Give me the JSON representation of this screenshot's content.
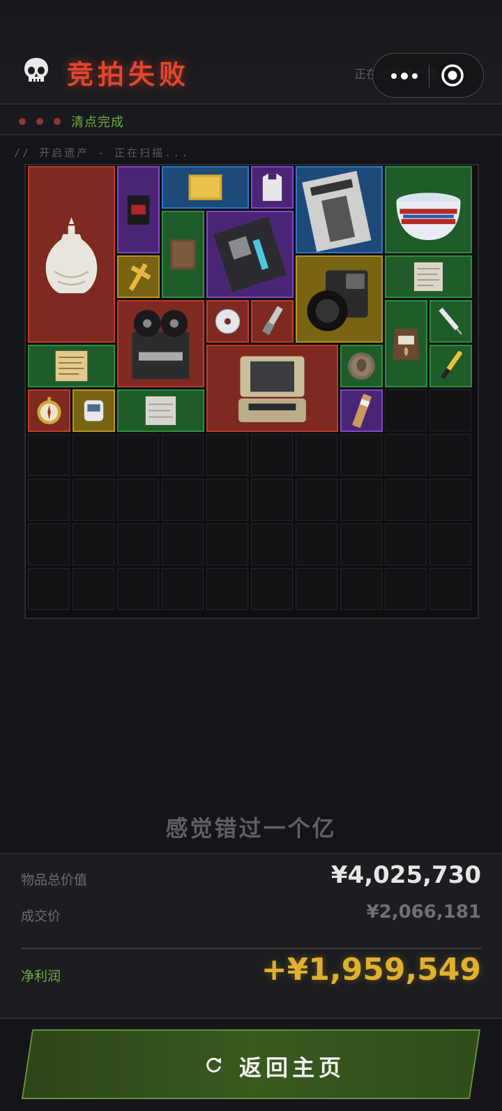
{
  "header": {
    "title": "竞拍失败",
    "restore_text": "正在还原遗产情...",
    "skull_icon": "skull-icon"
  },
  "status": {
    "text": "清点完成"
  },
  "scan": {
    "text": "// 开启遗产 - 正在扫描..."
  },
  "colors": {
    "red": "#c23a2b",
    "purple": "#8346c8",
    "gold": "#b59526",
    "blue": "#2f79c2",
    "green": "#2f8e3c",
    "profit": "#e0b02e",
    "accent_green": "#6fae45"
  },
  "grid": {
    "columns": 10,
    "rows": 10,
    "items": [
      {
        "name": "celadon-vase",
        "rarity": "red"
      },
      {
        "name": "coffee-pack",
        "rarity": "purple"
      },
      {
        "name": "gold-bar",
        "rarity": "blue"
      },
      {
        "name": "body-armor-vest",
        "rarity": "purple"
      },
      {
        "name": "fashion-magazine",
        "rarity": "blue"
      },
      {
        "name": "porcelain-pot",
        "rarity": "green"
      },
      {
        "name": "leather-notebook",
        "rarity": "green"
      },
      {
        "name": "motherboard",
        "rarity": "purple"
      },
      {
        "name": "golden-cross",
        "rarity": "gold"
      },
      {
        "name": "medium-format-camera",
        "rarity": "gold"
      },
      {
        "name": "old-letter",
        "rarity": "green"
      },
      {
        "name": "reel-to-reel-recorder",
        "rarity": "red"
      },
      {
        "name": "cd-disc",
        "rarity": "red"
      },
      {
        "name": "spark-plug",
        "rarity": "red"
      },
      {
        "name": "arabica-coffee-bag",
        "rarity": "green"
      },
      {
        "name": "syringe",
        "rarity": "green"
      },
      {
        "name": "old-map-document",
        "rarity": "green"
      },
      {
        "name": "rugged-laptop-case",
        "rarity": "red"
      },
      {
        "name": "antique-coin",
        "rarity": "green"
      },
      {
        "name": "voltage-tester-pen",
        "rarity": "green"
      },
      {
        "name": "pocket-compass",
        "rarity": "red"
      },
      {
        "name": "pulse-oximeter",
        "rarity": "gold"
      },
      {
        "name": "paper-scroll",
        "rarity": "green"
      },
      {
        "name": "energy-bar",
        "rarity": "purple"
      }
    ]
  },
  "quip": "感觉错过一个亿",
  "summary": {
    "total_label": "物品总价值",
    "total_value": "¥4,025,730",
    "deal_label": "成交价",
    "deal_value": "¥2,066,181",
    "profit_label": "净利润",
    "profit_value": "+¥1,959,549"
  },
  "home_button": {
    "label": "返回主页",
    "icon": "refresh-icon"
  },
  "capsule": {
    "more_icon": "more-dots-icon",
    "close_icon": "target-circle-icon"
  }
}
